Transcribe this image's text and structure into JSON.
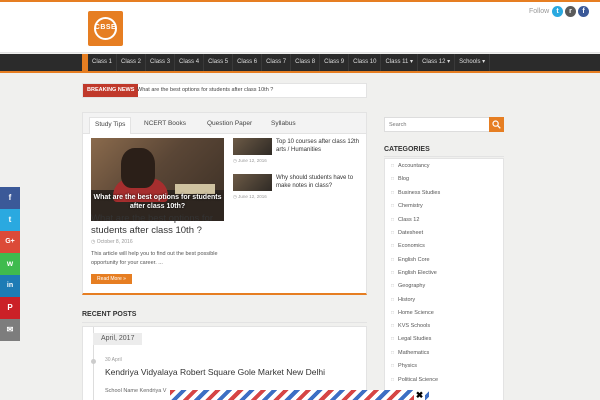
{
  "header": {
    "logo_text": "CBSE",
    "follow_label": "Follow",
    "social": [
      {
        "name": "twitter",
        "glyph": "t",
        "color": "#2aa9e0"
      },
      {
        "name": "rss",
        "glyph": "r",
        "color": "#5a5a5a"
      },
      {
        "name": "facebook",
        "glyph": "f",
        "color": "#3b5998"
      }
    ]
  },
  "nav": {
    "items": [
      "Class 1",
      "Class 2",
      "Class 3",
      "Class 4",
      "Class 5",
      "Class 6",
      "Class 7",
      "Class 8",
      "Class 9",
      "Class 10",
      "Class 11 ▾",
      "Class 12 ▾",
      "Schools ▾"
    ]
  },
  "breaking": {
    "label": "BREAKING NEWS",
    "text": "What are the best options for students after class 10th ?"
  },
  "tabs": {
    "labels": [
      "Study Tips",
      "NCERT Books",
      "Question Paper",
      "Syllabus"
    ]
  },
  "featured": {
    "image_caption": "What are the best options for students after class 10th?",
    "title": "What are the best options for students after class 10th ?",
    "date": "◷ October 8, 2016",
    "excerpt": "This article will help you to find out the best possible opportunity for your career. ...",
    "read_more": "Read More »"
  },
  "side_posts": [
    {
      "title": "Top 10 courses after class 12th arts / Humanities",
      "date": "◷ June 12, 2016"
    },
    {
      "title": "Why should students have to make notes in class?",
      "date": "◷ June 12, 2016"
    }
  ],
  "recent": {
    "heading": "RECENT POSTS",
    "month": "April, 2017",
    "day": "30 April",
    "title": "Kendriya Vidyalaya Robert Square Gole Market New Delhi",
    "excerpt": "School Name Kendriya V"
  },
  "search": {
    "placeholder": "Search"
  },
  "categories": {
    "heading": "CATEGORIES",
    "items": [
      "Accountancy",
      "Blog",
      "Business Studies",
      "Chemistry",
      "Class 12",
      "Datesheet",
      "Economics",
      "English Core",
      "English Elective",
      "Geography",
      "History",
      "Home Science",
      "KVS Schools",
      "Legal Studies",
      "Mathematics",
      "Physics",
      "Political Science"
    ]
  },
  "share": [
    {
      "name": "facebook",
      "glyph": "f",
      "color": "#3b5998"
    },
    {
      "name": "twitter",
      "glyph": "t",
      "color": "#2aa9e0"
    },
    {
      "name": "google-plus",
      "glyph": "G+",
      "color": "#dc4a38"
    },
    {
      "name": "whatsapp",
      "glyph": "w",
      "color": "#3fbb4e"
    },
    {
      "name": "linkedin",
      "glyph": "in",
      "color": "#1d7bb5"
    },
    {
      "name": "pinterest",
      "glyph": "P",
      "color": "#cb2027"
    },
    {
      "name": "email",
      "glyph": "✉",
      "color": "#7d7d7d"
    }
  ],
  "popup": {
    "close_glyph": "✖"
  },
  "colors": {
    "accent": "#e67e22",
    "nav_bg": "#2b2b2b",
    "breaking": "#c0392b"
  }
}
